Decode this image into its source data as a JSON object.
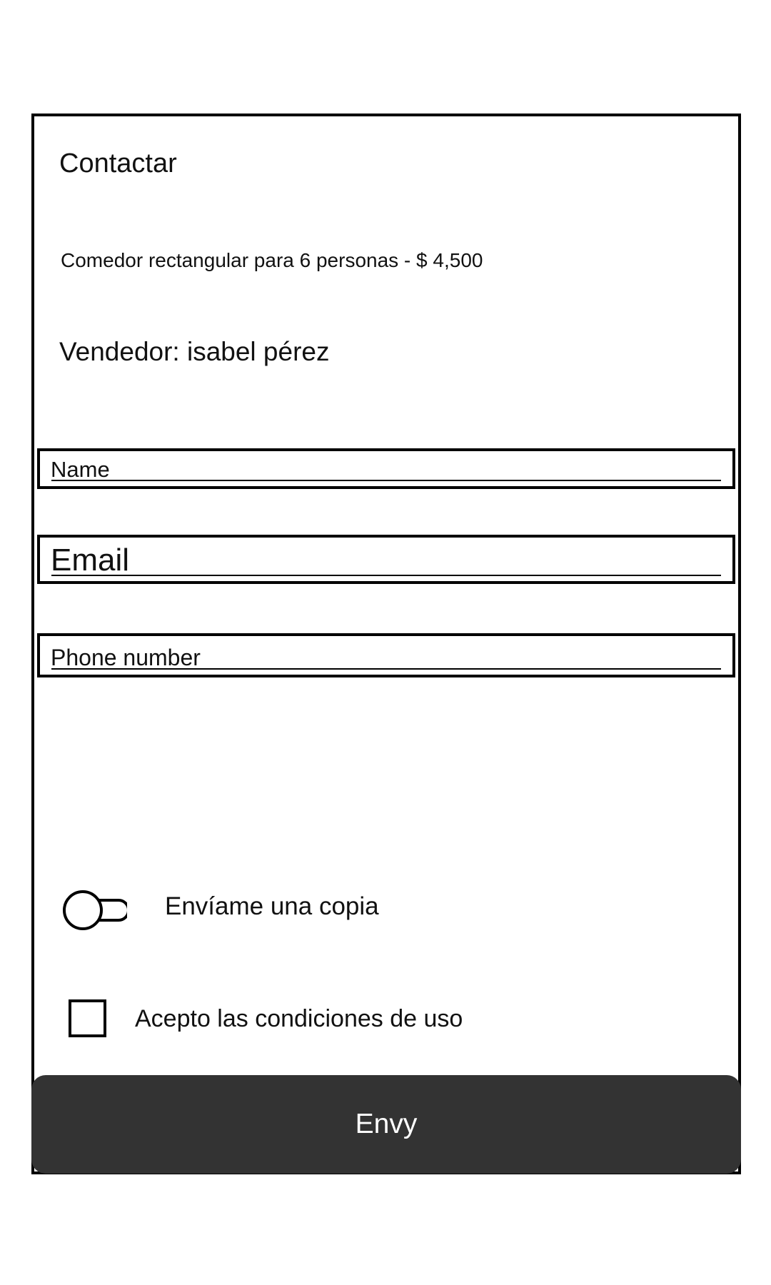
{
  "header": {
    "title": "Contactar"
  },
  "listing": {
    "product": "Comedor rectangular para 6 personas - $ 4,500",
    "seller": "Vendedor: isabel pérez"
  },
  "form": {
    "name_placeholder": "Name",
    "email_placeholder": "Email",
    "phone_placeholder": "Phone number",
    "copy_toggle_label": "Envíame una copia",
    "copy_toggle_on": false,
    "terms_label": "Acepto las condiciones de uso",
    "terms_checked": false,
    "submit_label": "Envy"
  },
  "icons": {
    "toggle": "toggle-switch-icon"
  },
  "colors": {
    "button_bg": "#333333",
    "button_text": "#ffffff",
    "border": "#000000"
  }
}
